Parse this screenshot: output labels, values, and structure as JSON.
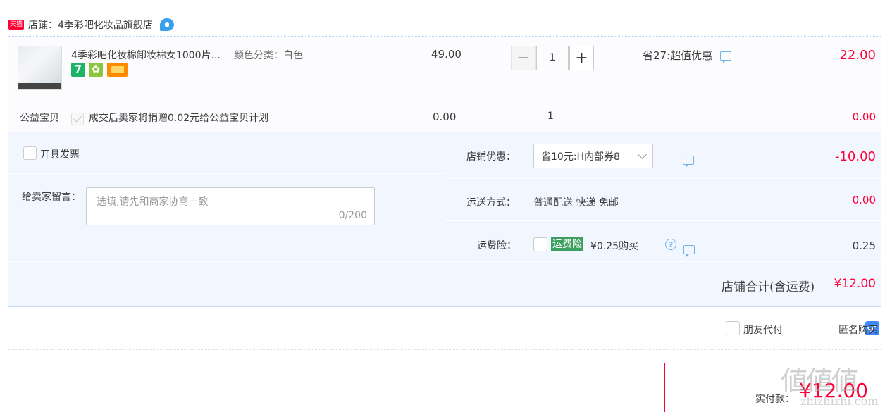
{
  "shop": {
    "badge": "天猫",
    "label": "店铺：",
    "name": "4季彩吧化妆品旗舰店"
  },
  "item": {
    "title": "4季彩吧化妆棉卸妆棉女1000片...",
    "sku": "颜色分类：白色",
    "tags": [
      "7",
      "✿",
      ""
    ],
    "price": "49.00",
    "quantity": "1",
    "minus": "−",
    "plus": "+",
    "promo": "省27:超值优惠",
    "subtotal": "22.00"
  },
  "charity": {
    "label": "公益宝贝",
    "desc": "成交后卖家将捐赠0.02元给公益宝贝计划",
    "price": "0.00",
    "qty": "1",
    "subtotal": "0.00"
  },
  "invoice": {
    "label": "开具发票"
  },
  "note": {
    "label": "给卖家留言：",
    "placeholder": "选填,请先和商家协商一致",
    "counter": "0/200"
  },
  "shop_discount": {
    "label": "店铺优惠：",
    "selected": "省10元:H内部券8",
    "amount": "-10.00"
  },
  "shipping": {
    "label": "运送方式：",
    "method": "普通配送 快递 免邮",
    "amount": "0.00"
  },
  "insurance": {
    "label": "运费险：",
    "tag": "运费险",
    "price_text": "¥0.25购买",
    "amount": "0.25"
  },
  "shop_total": {
    "label": "店铺合计(含运费)",
    "amount": "¥12.00"
  },
  "options": {
    "friend_pay": "朋友代付",
    "anonymous": "匿名购买"
  },
  "pay": {
    "label": "实付款：",
    "amount": "¥12.00"
  },
  "watermark": {
    "glyphs": "値値値",
    "url": "zhizhizhi.com"
  },
  "colors": {
    "accent_red": "#ff0036",
    "checkbox_blue": "#3e89fa",
    "options_bg": "#f2f7ff",
    "insurance_green": "#3c9f5f"
  }
}
